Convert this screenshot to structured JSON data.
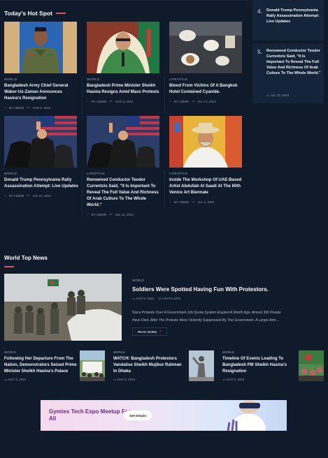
{
  "hot_spot": {
    "title": "Today's Hot Spot",
    "row1": [
      {
        "category": "WORLD",
        "title": "Bangladesh Army Chief General Waker-Us-Zaman Announces Hasina's Resignation",
        "author": "BY ADMIN",
        "date": "AUG 5, 2024"
      },
      {
        "category": "WORLD",
        "title": "Bangladesh Prime Minister Sheikh Hasina Resigns Amid Mass Protests",
        "author": "BY ADMIN",
        "date": "AUG 5, 2024"
      },
      {
        "category": "LIFESTYLE",
        "title": "Blood From Victims Of A Bangkok Hotel Contained Cyanide.",
        "author": "BY ADMIN",
        "date": "JUL 17, 2024"
      }
    ],
    "row2": [
      {
        "category": "WORLD",
        "title": "Donald Trump Pennsylvania Rally Assassination Attempt: Live Updates",
        "author": "BY ADMIN",
        "date": "JUL 15, 2024"
      },
      {
        "category": "LIFESTYLE",
        "title": "Renowned Conductor Teodor Currentzis Said, \"It Is Important To Reveal The Full Value And Richness Of Arab Culture To The Whole World.\"",
        "author": "BY ADMIN",
        "date": "JUL 13, 2024"
      },
      {
        "category": "LIFESTYLE",
        "title": "Inside The Workshop Of UAE-Based Artist Abdullah Al Saadi At The 60th Venice Art Biennale",
        "author": "BY ADMIN",
        "date": "JUL 3, 2024"
      }
    ]
  },
  "sidebar": [
    {
      "num": "4.",
      "title": "Donald Trump Pennsylvania Rally Assassination Attempt: Live Updates",
      "date": ""
    },
    {
      "num": "5.",
      "title": "Renowned Conductor Teodor Currentzis Said, \"It Is Important To Reveal The Full Value And Richness Of Arab Culture To The Whole World.\"",
      "date": "JUL 13, 2024"
    }
  ],
  "world_top": {
    "title": "World Top News",
    "featured": {
      "category": "WORLD",
      "title": "Soldiers Were Spotted Having Fun With Protestors.",
      "date": "AUG 5, 2024",
      "ago": "2 DAYS AGO",
      "desc1": "Since Protests Over A Government Job Quota System Erupted A Month Ago, Almost 300 People",
      "desc2": "Have Died. After The Protests Were Violently Suppressed By The Government. A Larger Anti-...",
      "read_more": "READ MORE"
    },
    "small": [
      {
        "category": "WORLD",
        "title": "Following Her Departure From The Nation, Demonstrators Seized Prime Minister Sheikh Hasina's Palace",
        "date": "AUG 5, 2024"
      },
      {
        "category": "WORLD",
        "title": "WATCH: Bangladesh Protestors Vandalise Sheikh Mujibur Rahman In Dhaka",
        "date": "AUG 5, 2024"
      },
      {
        "category": "WORLD",
        "title": "Timeline Of Events Leading To Bangladesh PM Sheikh Hasina's Resignation",
        "date": "AUG 5, 2024"
      }
    ]
  },
  "banner": {
    "title": "Gymtex Tech Expo Meetup For All",
    "button": "See Details"
  }
}
